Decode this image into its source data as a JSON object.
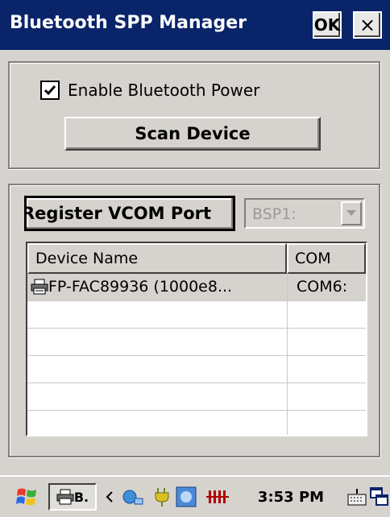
{
  "window": {
    "title": "Bluetooth SPP Manager",
    "ok_label": "OK",
    "close_label": "×"
  },
  "power": {
    "checkbox_label": "Enable Bluetooth Power",
    "checked": true,
    "scan_label": "Scan Device"
  },
  "vcom": {
    "register_label": "Register VCOM Port",
    "port_select": "BSP1:"
  },
  "device_list": {
    "columns": [
      "Device Name",
      "COM"
    ],
    "rows": [
      {
        "name": "FP-FAC89936 (1000e8...",
        "com": "COM6:"
      }
    ]
  },
  "taskbar": {
    "task_label": "B.",
    "clock": "3:53 PM"
  },
  "colors": {
    "title_bar": "#0a246a",
    "face": "#d6d3ce"
  }
}
